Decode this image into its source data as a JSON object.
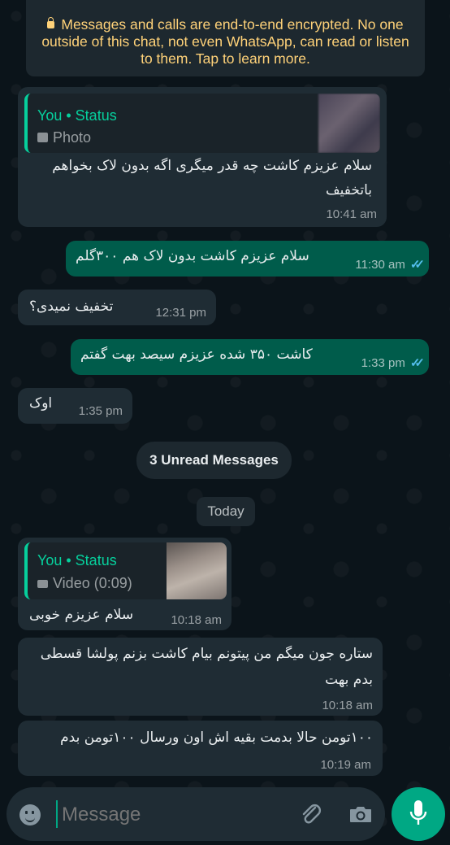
{
  "encryption_notice": "Messages and calls are end-to-end encrypted. No one outside of this chat, not even WhatsApp, can read or listen to them. Tap to learn more.",
  "messages": [
    {
      "reply": {
        "author": "You • Status",
        "media": "Photo"
      },
      "text": "سلام عزیزم کاشت چه قدر میگری اگه بدون لاک بخواهم باتخفیف",
      "time": "10:41 am"
    },
    {
      "text": "سلام عزیزم کاشت بدون لاک هم ۳۰۰گلم",
      "time": "11:30 am",
      "ticks": "✓✓"
    },
    {
      "text": "تخفیف  نمیدی؟",
      "time": "12:31 pm"
    },
    {
      "text": "کاشت ۳۵۰ شده عزیزم سیصد بهت گفتم",
      "time": "1:33 pm",
      "ticks": "✓✓"
    },
    {
      "text": "اوک",
      "time": "1:35 pm"
    },
    {
      "reply": {
        "author": "You • Status",
        "media": "Video (0:09)"
      },
      "text": "سلام عزیزم خوبی",
      "time": "10:18 am"
    },
    {
      "text": "ستاره جون میگم من پیتونم بیام کاشت بزنم پولشا قسطی بدم بهت",
      "time": "10:18 am"
    },
    {
      "text": "۱۰۰تومن حالا بدمت بقیه اش اون ورسال ۱۰۰تومن بدم",
      "time": "10:19 am"
    }
  ],
  "unread_label": "3 Unread Messages",
  "date_label": "Today",
  "composer": {
    "placeholder": "Message"
  },
  "colors": {
    "incoming": "#1f2c34",
    "outgoing": "#005c4b",
    "accent": "#00a884",
    "quote_author": "#06cf9c",
    "notice_text": "#ffd279"
  }
}
